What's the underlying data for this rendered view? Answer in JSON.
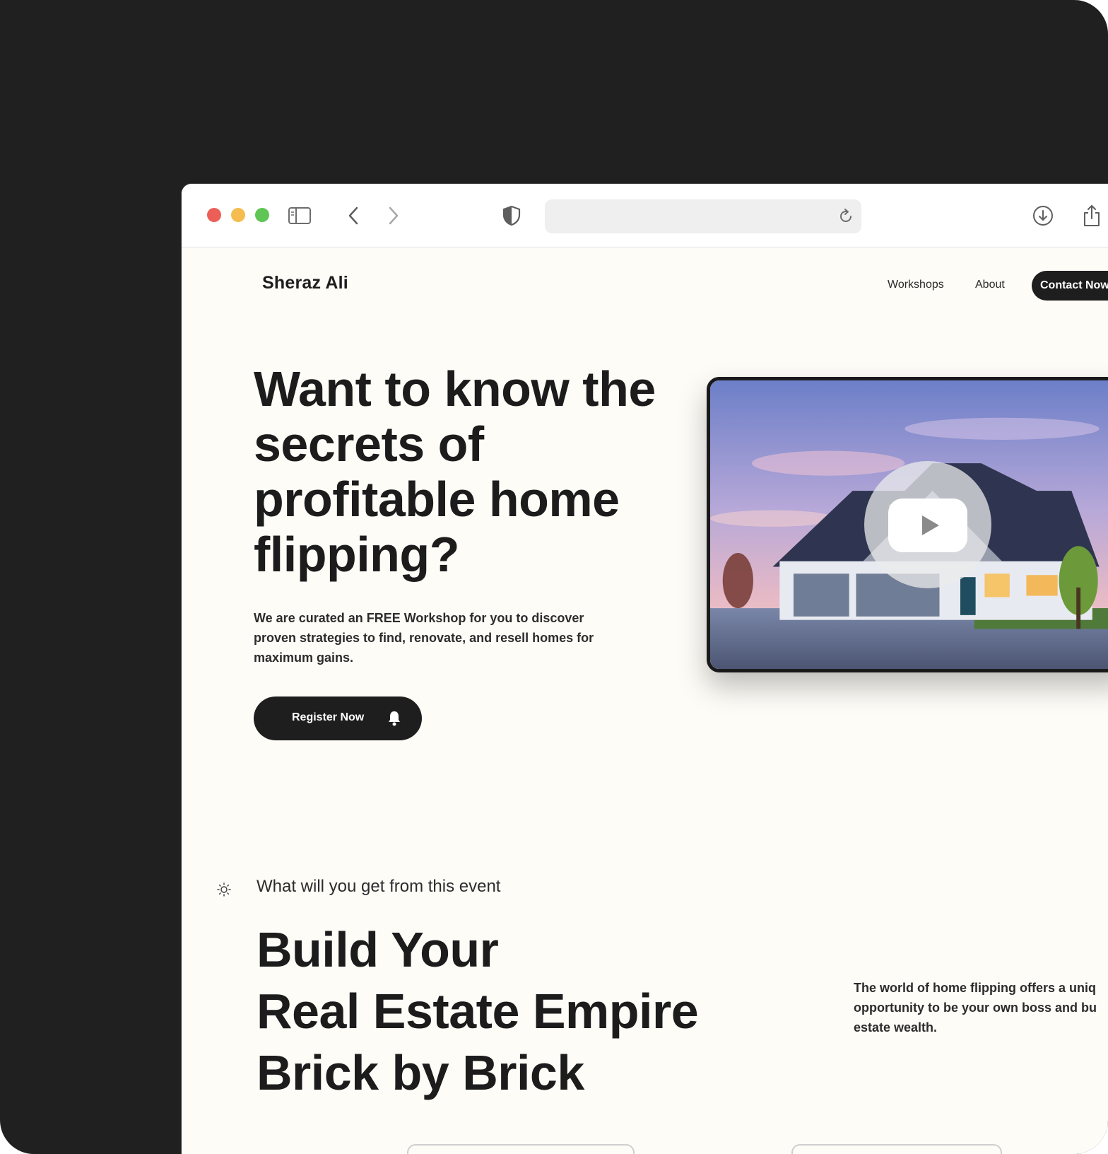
{
  "browser": {
    "traffic_lights": [
      "close",
      "minimize",
      "zoom"
    ],
    "toolbar_icons": [
      "sidebar-icon",
      "back-icon",
      "forward-icon",
      "shield-icon",
      "reload-icon",
      "download-icon",
      "share-icon"
    ],
    "url": ""
  },
  "site": {
    "logo": "Sheraz Ali",
    "nav": {
      "workshops": "Workshops",
      "about": "About",
      "contact": "Contact Now"
    }
  },
  "hero": {
    "title": "Want to know the secrets of profitable home flipping?",
    "description": "We are curated an FREE Workshop for you to discover proven strategies to find, renovate, and resell homes for maximum gains.",
    "register_label": "Register Now",
    "register_icon": "bell-icon",
    "video_icon": "play-icon"
  },
  "section": {
    "eyebrow": "What will you get from this event",
    "eyebrow_icon": "sun-icon",
    "title_lines": [
      "Build Your",
      "Real Estate Empire",
      "Brick by Brick"
    ],
    "description": "The world of home flipping offers a uniq opportunity to be your own boss and bu estate wealth."
  },
  "colors": {
    "frame": "#202020",
    "page_bg": "#fdfcf7",
    "primary": "#1e1e1e",
    "text": "#2c2c2c"
  }
}
